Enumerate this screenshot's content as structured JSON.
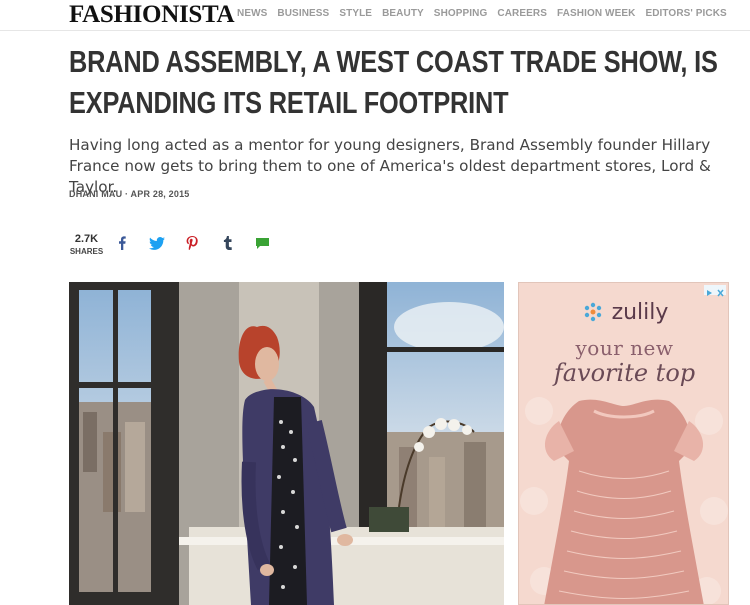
{
  "site": {
    "logo": "FASHIONISTA"
  },
  "nav": [
    "NEWS",
    "BUSINESS",
    "STYLE",
    "BEAUTY",
    "SHOPPING",
    "CAREERS",
    "FASHION WEEK",
    "EDITORS' PICKS"
  ],
  "article": {
    "headline_line1": "BRAND ASSEMBLY, A WEST COAST TRADE SHOW, IS",
    "headline_line2": "EXPANDING ITS RETAIL FOOTPRINT",
    "dek": "Having long acted as a mentor for young designers, Brand Assembly founder Hillary France now gets to bring them to one of America's oldest department stores, Lord & Taylor.",
    "byline": "DHANI MAU · APR 28, 2015"
  },
  "shares": {
    "count": "2.7K",
    "label": "SHARES"
  },
  "social_icons": [
    "facebook-icon",
    "twitter-icon",
    "pinterest-icon",
    "tumblr-icon",
    "comment-icon"
  ],
  "colors": {
    "facebook": "#3b5998",
    "twitter": "#1da1f2",
    "pinterest": "#cb2027",
    "tumblr": "#35465c",
    "comment": "#3aa335"
  },
  "ad": {
    "brand": "zulily",
    "line1": "your new",
    "line2": "favorite top"
  }
}
